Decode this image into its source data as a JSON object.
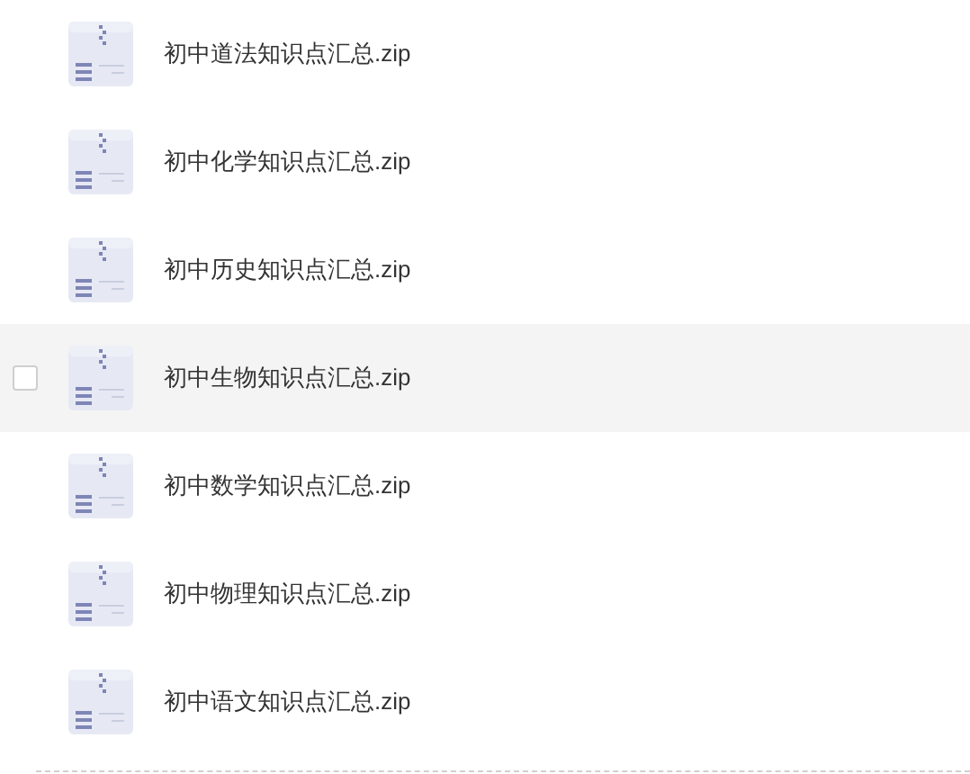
{
  "files": [
    {
      "name": "初中道法知识点汇总.zip",
      "hovered": false
    },
    {
      "name": "初中化学知识点汇总.zip",
      "hovered": false
    },
    {
      "name": "初中历史知识点汇总.zip",
      "hovered": false
    },
    {
      "name": "初中生物知识点汇总.zip",
      "hovered": true
    },
    {
      "name": "初中数学知识点汇总.zip",
      "hovered": false
    },
    {
      "name": "初中物理知识点汇总.zip",
      "hovered": false
    },
    {
      "name": "初中语文知识点汇总.zip",
      "hovered": false
    }
  ]
}
